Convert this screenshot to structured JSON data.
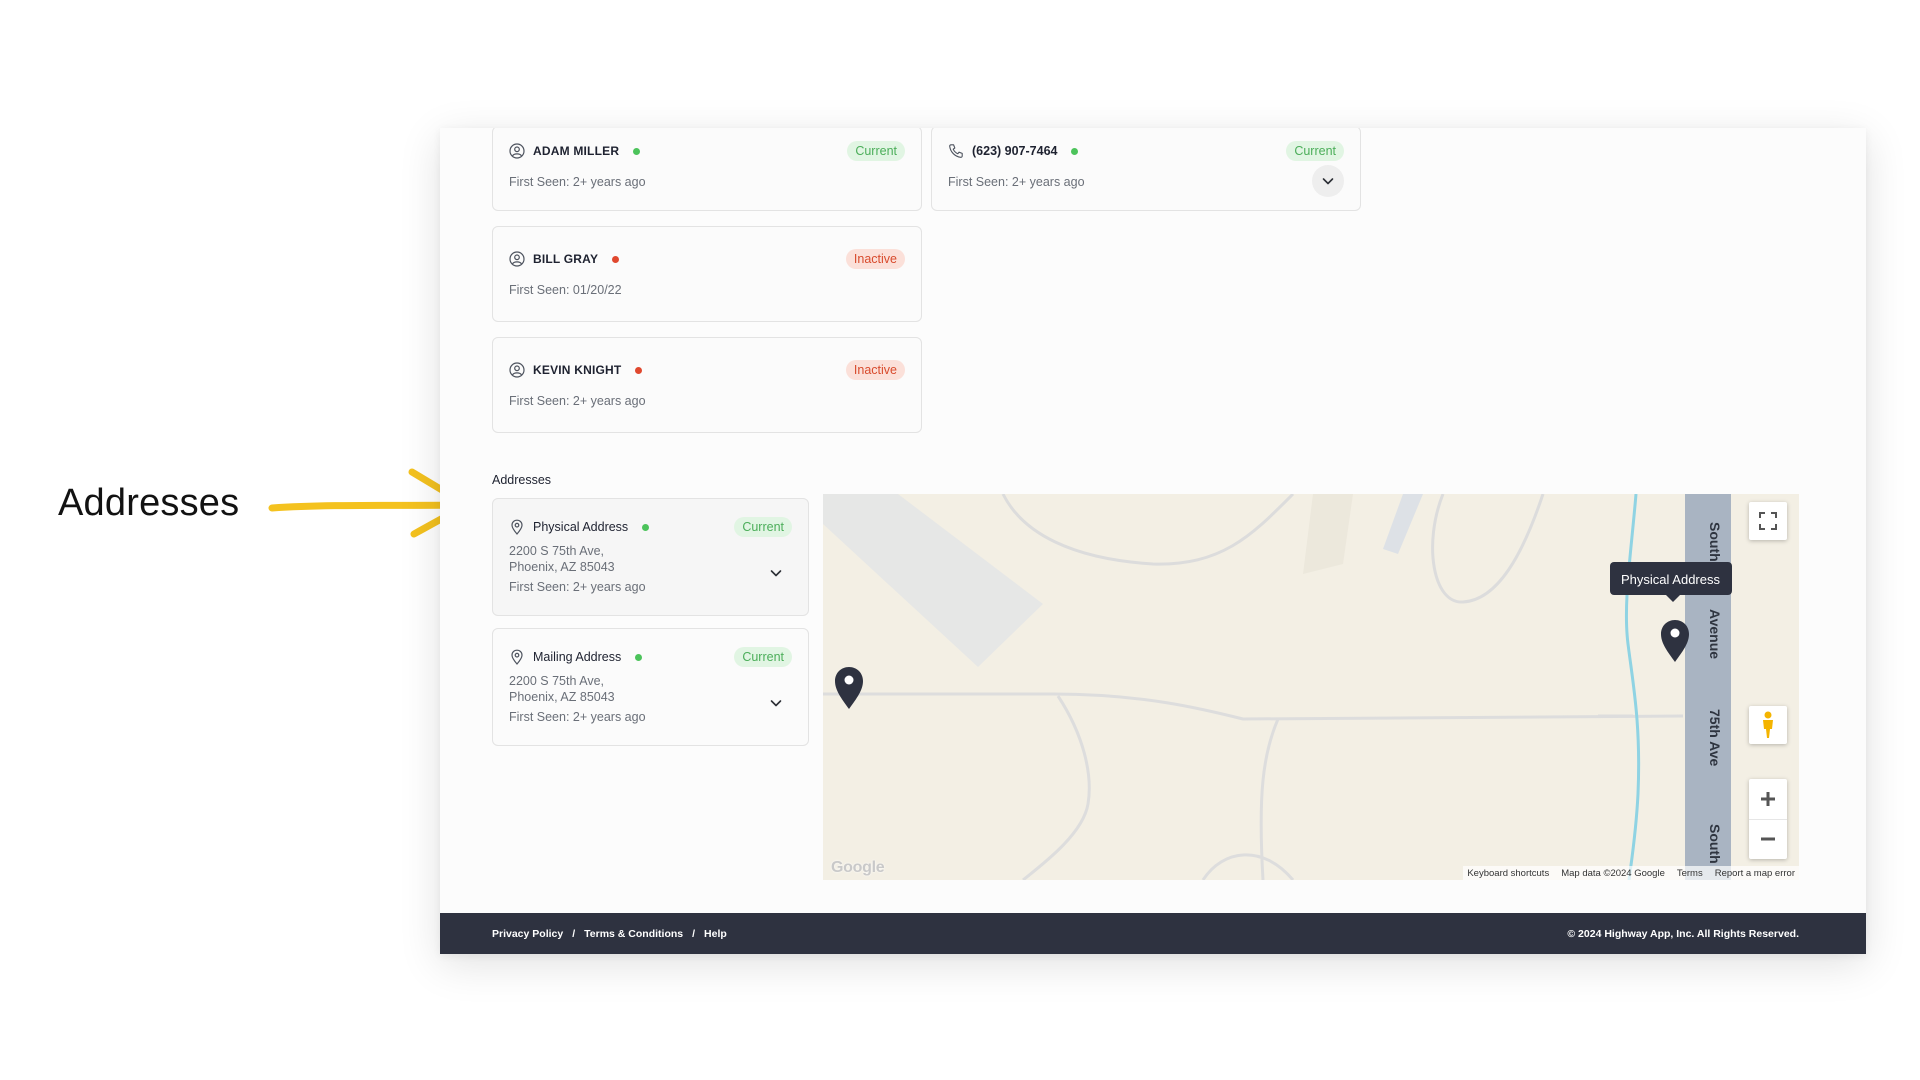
{
  "annotation": {
    "label": "Addresses"
  },
  "contacts": [
    {
      "name": "ADAM MILLER",
      "status": "Current",
      "first_seen": "First Seen: 2+ years ago"
    },
    {
      "name": "BILL GRAY",
      "status": "Inactive",
      "first_seen": "First Seen: 01/20/22"
    },
    {
      "name": "KEVIN KNIGHT",
      "status": "Inactive",
      "first_seen": "First Seen: 2+ years ago"
    }
  ],
  "phone": {
    "number": "(623) 907-7464",
    "status": "Current",
    "first_seen": "First Seen: 2+ years ago"
  },
  "addresses": {
    "section_title": "Addresses",
    "items": [
      {
        "type": "Physical Address",
        "status": "Current",
        "line1": "2200 S 75th Ave,",
        "line2": "Phoenix, AZ 85043",
        "first_seen": "First Seen: 2+ years ago"
      },
      {
        "type": "Mailing Address",
        "status": "Current",
        "line1": "2200 S 75th Ave,",
        "line2": "Phoenix, AZ 85043",
        "first_seen": "First Seen: 2+ years ago"
      }
    ]
  },
  "map": {
    "tooltip": "Physical Address",
    "road_label_top": "South",
    "road_label_mid": "Avenue",
    "road_label_low": "75th Ave",
    "road_label_bottom": "South",
    "google_logo": "Google",
    "legal": {
      "shortcuts": "Keyboard shortcuts",
      "data": "Map data ©2024 Google",
      "terms": "Terms",
      "report": "Report a map error"
    }
  },
  "footer": {
    "privacy": "Privacy Policy",
    "sep": "/",
    "terms": "Terms & Conditions",
    "help": "Help",
    "copyright": "© 2024 Highway App, Inc. All Rights Reserved."
  },
  "colors": {
    "current_bg": "#e1f5e3",
    "current_text": "#4cae5a",
    "inactive_bg": "#fbe0d9",
    "inactive_text": "#d84b2d",
    "footer_bg": "#2e3240",
    "arrow": "#f4c21f"
  },
  "icons": {
    "person": "user-circle-icon",
    "phone": "phone-icon",
    "pin": "map-pin-icon",
    "chevron": "chevron-down-icon"
  }
}
